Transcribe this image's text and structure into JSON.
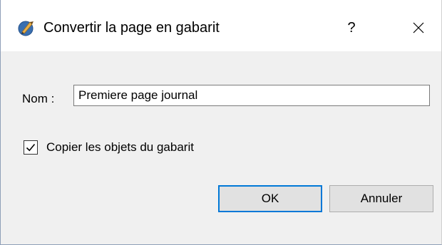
{
  "window": {
    "title": "Convertir la page en gabarit",
    "help_label": "?",
    "app_icon": "pen-nib-icon",
    "close_icon": "close-icon"
  },
  "form": {
    "name_label": "Nom :",
    "name_value": "Premiere page journal",
    "copy_objects_label": "Copier les objets du gabarit",
    "copy_objects_checked": true
  },
  "buttons": {
    "ok_label": "OK",
    "cancel_label": "Annuler"
  },
  "colors": {
    "accent": "#0078d7",
    "dialog_bg": "#f0f0f0",
    "titlebar_bg": "#ffffff"
  }
}
